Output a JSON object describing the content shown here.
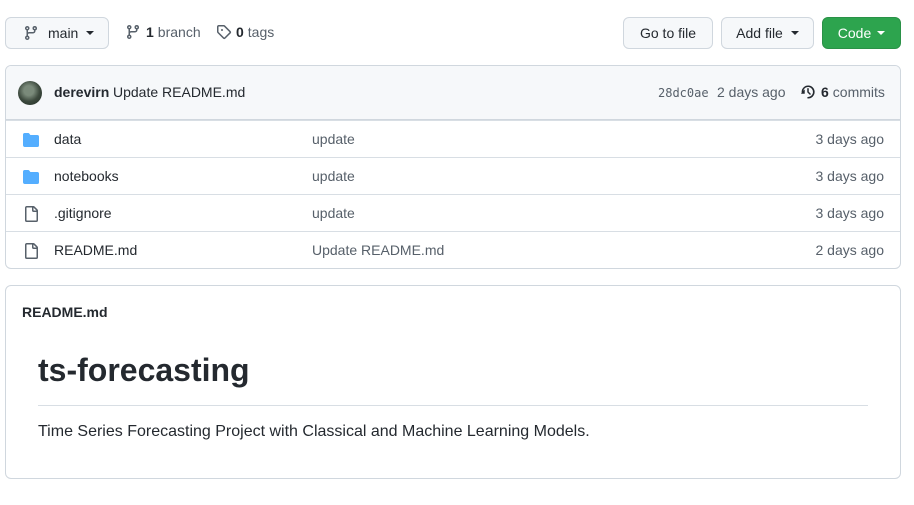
{
  "branch_selector": {
    "label": "main",
    "icon": "git-branch-icon"
  },
  "branches": {
    "count": "1",
    "label": "branch"
  },
  "tags": {
    "count": "0",
    "label": "tags"
  },
  "buttons": {
    "goto_file": "Go to file",
    "add_file": "Add file",
    "code": "Code"
  },
  "colors": {
    "code_button": "#2da44e",
    "folder_icon": "#54aeff",
    "border": "#d0d7de"
  },
  "commit": {
    "author": "derevirn",
    "message": "Update README.md",
    "sha": "28dc0ae",
    "age": "2 days ago",
    "commits_count": "6",
    "commits_label": "commits"
  },
  "files": [
    {
      "type": "folder",
      "name": "data",
      "commit": "update",
      "age": "3 days ago"
    },
    {
      "type": "folder",
      "name": "notebooks",
      "commit": "update",
      "age": "3 days ago"
    },
    {
      "type": "file",
      "name": ".gitignore",
      "commit": "update",
      "age": "3 days ago"
    },
    {
      "type": "file",
      "name": "README.md",
      "commit": "Update README.md",
      "age": "2 days ago"
    }
  ],
  "readme": {
    "filename": "README.md",
    "heading": "ts-forecasting",
    "description": "Time Series Forecasting Project with Classical and Machine Learning Models."
  }
}
